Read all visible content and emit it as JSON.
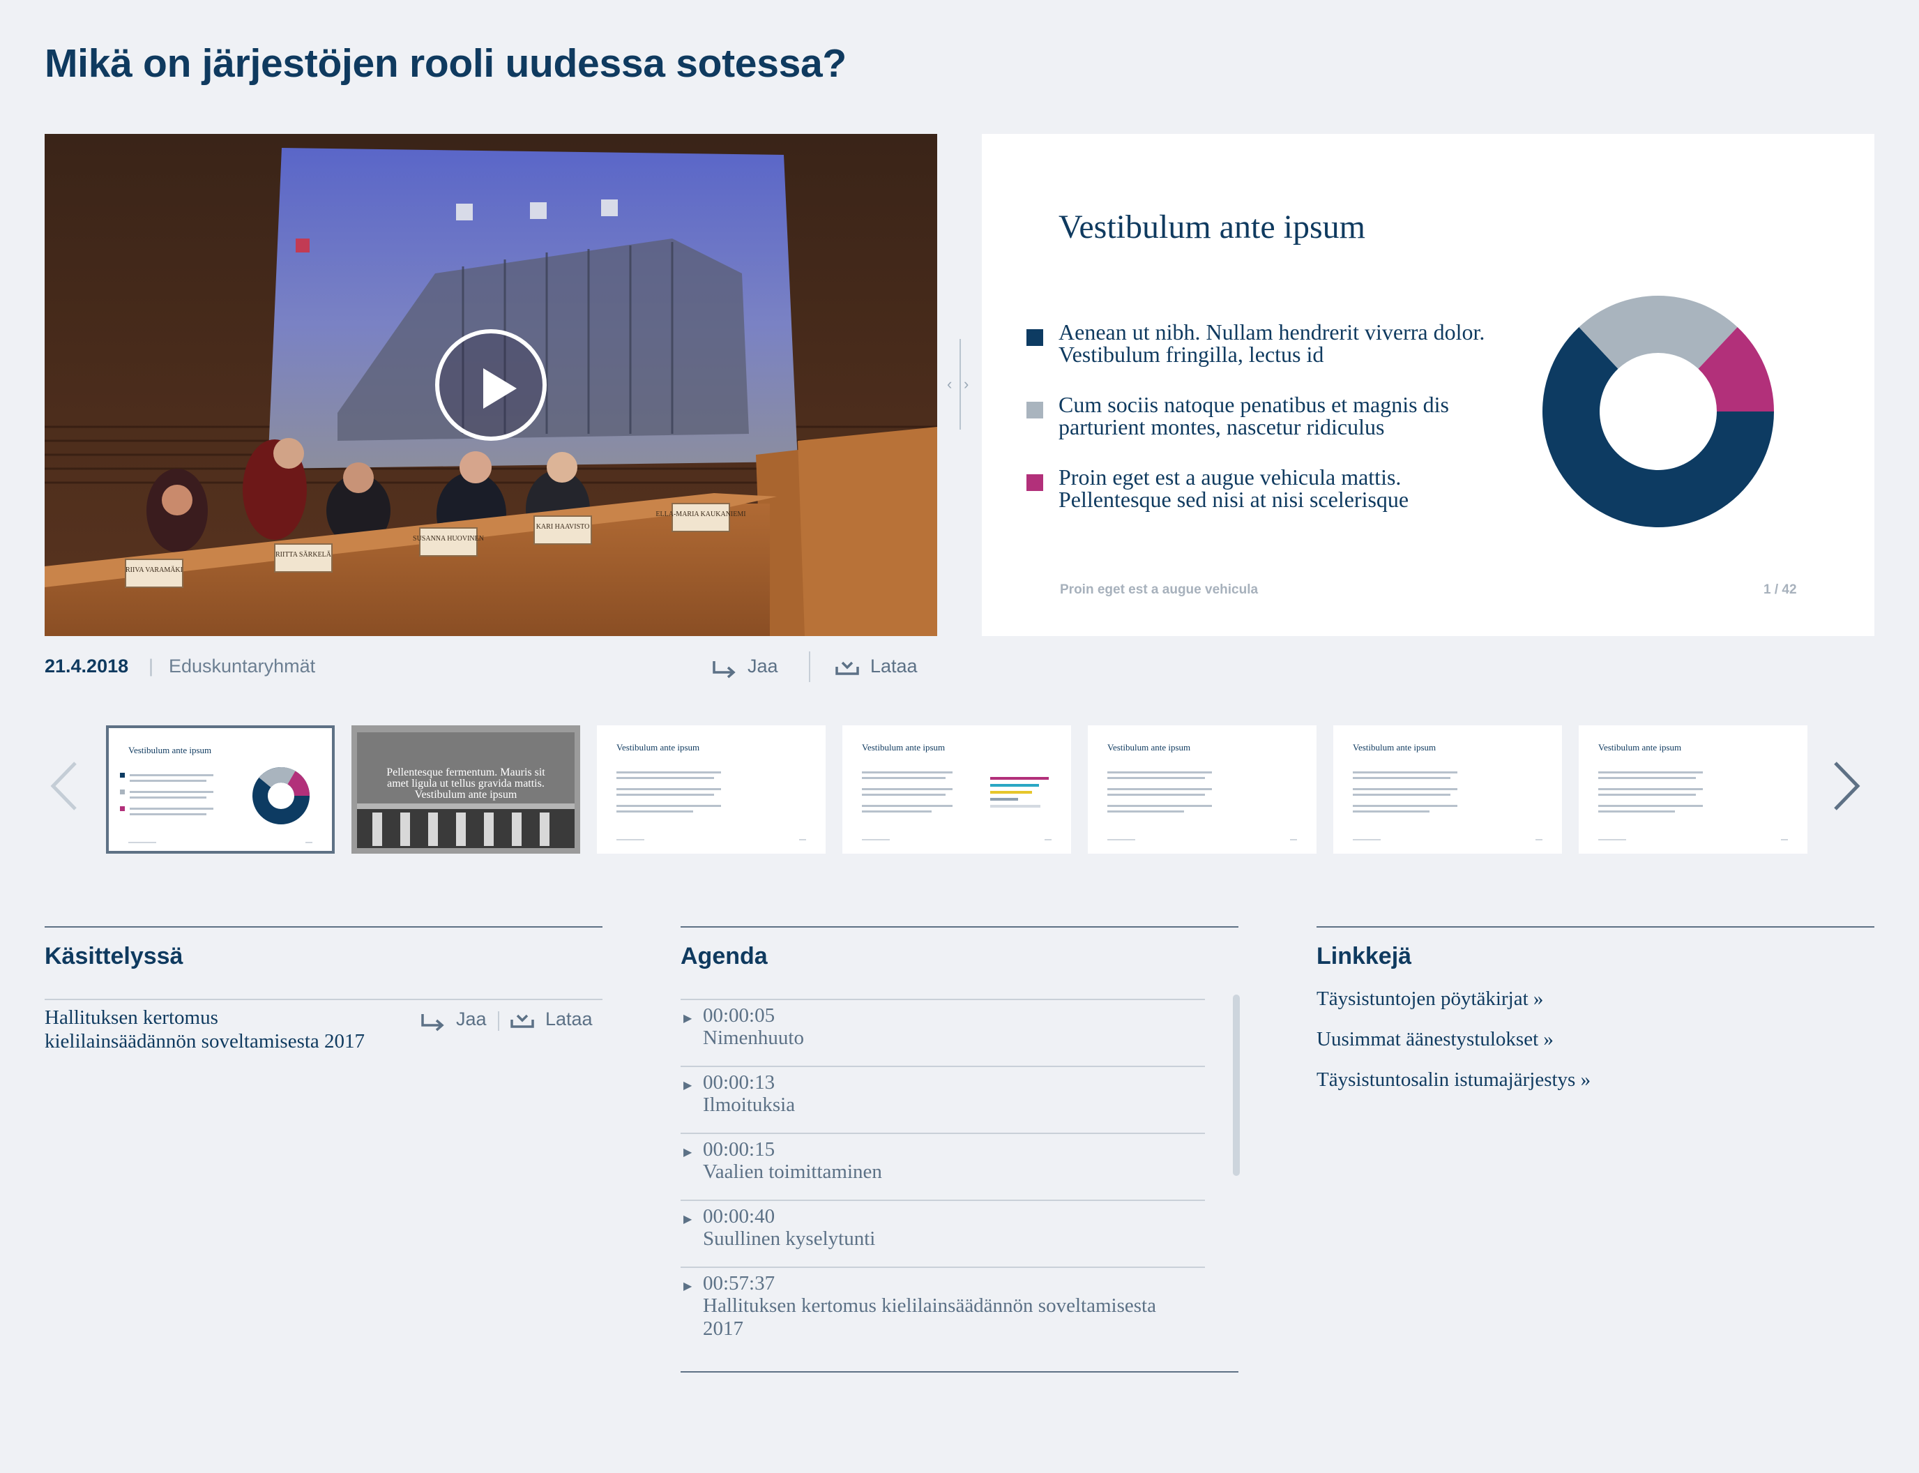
{
  "page_title": "Mikä on järjestöjen rooli uudessa sotessa?",
  "video": {
    "nameplates": [
      "RIIVA VARAMÄKI",
      "RIITTA SÄRKELÄ",
      "SUSANNA HUOVINEN",
      "KARI HAAVISTO",
      "ELLA-MARIA KAUKANIEMI"
    ]
  },
  "slide": {
    "title": "Vestibulum ante ipsum",
    "bullets": [
      {
        "text": "Aenean ut nibh. Nullam hendrerit viverra dolor. Vestibulum fringilla, lectus id",
        "color": "#0d3b62"
      },
      {
        "text": "Cum sociis natoque penatibus et magnis dis parturient montes, nascetur ridiculus",
        "color": "#a9b4be"
      },
      {
        "text": "Proin eget est a augue vehicula mattis. Pellentesque sed nisi at nisi scelerisque",
        "color": "#b2307a"
      }
    ],
    "footer": "Proin eget est a augue vehicula",
    "page": "1 / 42",
    "donut": [
      {
        "share": 0.63,
        "color": "#0d3b62"
      },
      {
        "share": 0.24,
        "color": "#a9b4be"
      },
      {
        "share": 0.13,
        "color": "#b2307a"
      }
    ]
  },
  "meta": {
    "date": "21.4.2018",
    "separator": "|",
    "group": "Eduskuntaryhmät",
    "share_label": "Jaa",
    "download_label": "Lataa"
  },
  "thumbnails": {
    "active_index": 0,
    "items": [
      {
        "title": "Vestibulum ante ipsum",
        "kind": "donut"
      },
      {
        "title": "Pellentesque fermentum. Mauris sit amet ligula ut tellus gravida mattis. Vestibulum ante ipsum",
        "kind": "photo"
      },
      {
        "title": "Vestibulum ante ipsum",
        "kind": "text"
      },
      {
        "title": "Vestibulum ante ipsum",
        "kind": "bars"
      },
      {
        "title": "Vestibulum ante ipsum",
        "kind": "text"
      },
      {
        "title": "Vestibulum ante ipsum",
        "kind": "text"
      },
      {
        "title": "Vestibulum ante ipsum",
        "kind": "text"
      }
    ]
  },
  "kasittelyssa": {
    "heading": "Käsittelyssä",
    "item": "Hallituksen kertomus kielilainsäädännön soveltamisesta 2017",
    "share_label": "Jaa",
    "download_label": "Lataa"
  },
  "agenda": {
    "heading": "Agenda",
    "items": [
      {
        "time": "00:00:05",
        "name": "Nimenhuuto"
      },
      {
        "time": "00:00:13",
        "name": "Ilmoituksia"
      },
      {
        "time": "00:00:15",
        "name": "Vaalien toimittaminen"
      },
      {
        "time": "00:00:40",
        "name": "Suullinen kyselytunti"
      },
      {
        "time": "00:57:37",
        "name": "Hallituksen kertomus kielilainsäädännön soveltamisesta 2017"
      }
    ]
  },
  "links": {
    "heading": "Linkkejä",
    "items": [
      "Täysistuntojen pöytäkirjat »",
      "Uusimmat äänestystulokset »",
      "Täysistuntosalin istumajärjestys »"
    ]
  },
  "colors": {
    "navy": "#0f3a5f",
    "muted": "#5c7186",
    "background": "#eff1f5",
    "accent_magenta": "#b2307a"
  }
}
